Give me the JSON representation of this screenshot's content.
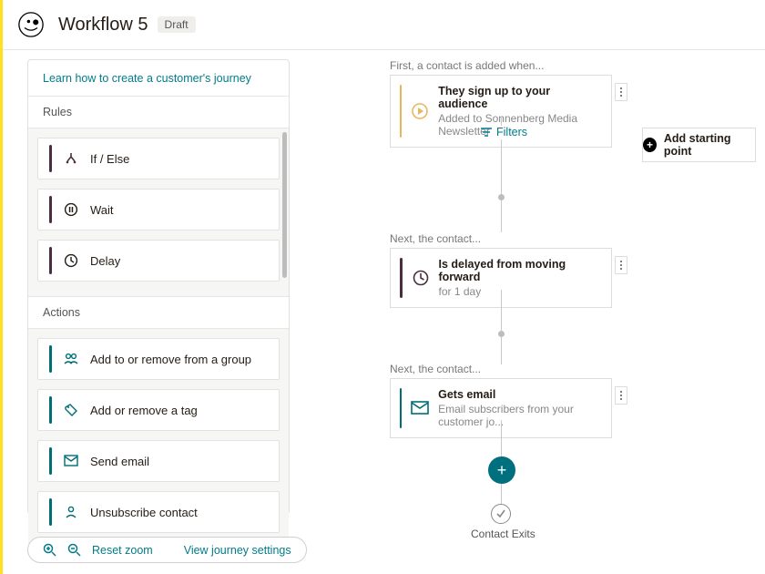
{
  "header": {
    "title": "Workflow 5",
    "status": "Draft"
  },
  "sidebar": {
    "learn_link": "Learn how to create a customer's journey",
    "rules_title": "Rules",
    "actions_title": "Actions",
    "rules": [
      {
        "label": "If / Else"
      },
      {
        "label": "Wait"
      },
      {
        "label": "Delay"
      }
    ],
    "actions": [
      {
        "label": "Add to or remove from a group"
      },
      {
        "label": "Add or remove a tag"
      },
      {
        "label": "Send email"
      },
      {
        "label": "Unsubscribe contact"
      }
    ]
  },
  "zoombar": {
    "reset": "Reset zoom",
    "settings": "View journey settings"
  },
  "canvas": {
    "hint_start": "First, a contact is added when...",
    "hint_next1": "Next, the contact...",
    "hint_next2": "Next, the contact...",
    "start_button": "Add starting point",
    "filters": "Filters",
    "exit_label": "Contact Exits",
    "node_start": {
      "title": "They sign up to your audience",
      "sub": "Added to Sonnenberg Media Newsletter"
    },
    "node_delay": {
      "title": "Is delayed from moving forward",
      "sub": "for 1 day"
    },
    "node_email": {
      "title": "Gets email",
      "sub": "Email subscribers from your customer jo..."
    }
  },
  "colors": {
    "teal": "#007c89",
    "maroon": "#4b2d3f",
    "amber": "#e7b75f",
    "yellow": "#ffe01b"
  }
}
